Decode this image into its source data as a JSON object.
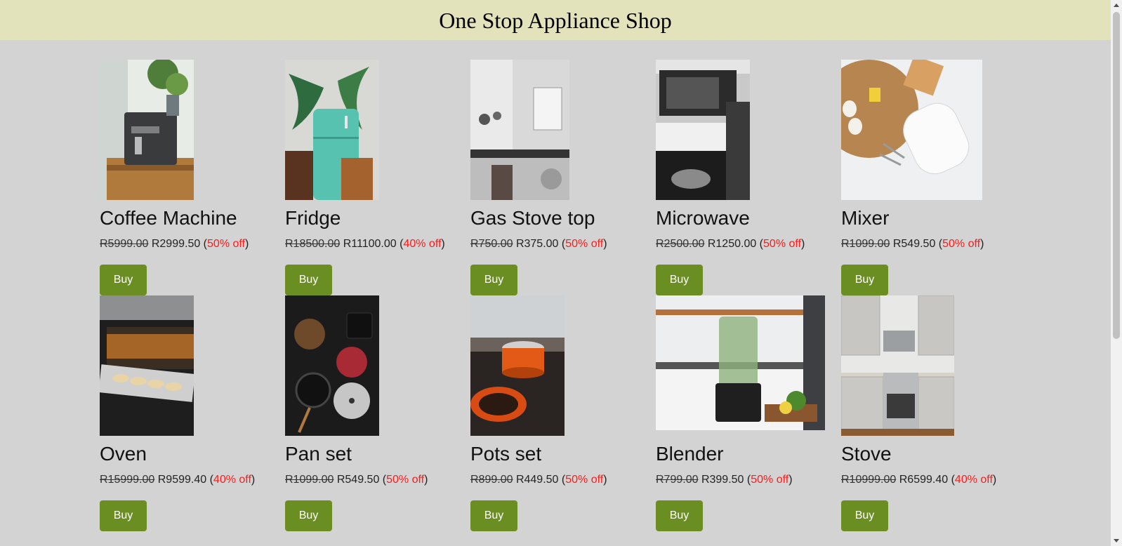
{
  "header": {
    "title": "One Stop Appliance Shop"
  },
  "buy_label": "Buy",
  "colors": {
    "header_bg": "#e2e2bb",
    "page_bg": "#d3d3d3",
    "buy_button": "#6b8e23",
    "discount_text": "#ff1a1a"
  },
  "products": [
    {
      "name": "Coffee Machine",
      "old_price": "R5999.00",
      "new_price": "R2999.50",
      "discount": "50% off",
      "image_icon": "coffee-machine-photo"
    },
    {
      "name": "Fridge",
      "old_price": "R18500.00",
      "new_price": "R11100.00",
      "discount": "40% off",
      "image_icon": "fridge-photo"
    },
    {
      "name": "Gas Stove top",
      "old_price": "R750.00",
      "new_price": "R375.00",
      "discount": "50% off",
      "image_icon": "kitchen-photo"
    },
    {
      "name": "Microwave",
      "old_price": "R2500.00",
      "new_price": "R1250.00",
      "discount": "50% off",
      "image_icon": "microwave-photo"
    },
    {
      "name": "Mixer",
      "old_price": "R1099.00",
      "new_price": "R549.50",
      "discount": "50% off",
      "image_icon": "mixer-photo"
    },
    {
      "name": "Oven",
      "old_price": "R15999.00",
      "new_price": "R9599.40",
      "discount": "40% off",
      "image_icon": "oven-photo"
    },
    {
      "name": "Pan set",
      "old_price": "R1099.00",
      "new_price": "R549.50",
      "discount": "50% off",
      "image_icon": "pan-set-photo"
    },
    {
      "name": "Pots set",
      "old_price": "R899.00",
      "new_price": "R449.50",
      "discount": "50% off",
      "image_icon": "pots-set-photo"
    },
    {
      "name": "Blender",
      "old_price": "R799.00",
      "new_price": "R399.50",
      "discount": "50% off",
      "image_icon": "blender-photo"
    },
    {
      "name": "Stove",
      "old_price": "R10999.00",
      "new_price": "R6599.40",
      "discount": "40% off",
      "image_icon": "stove-photo"
    }
  ]
}
